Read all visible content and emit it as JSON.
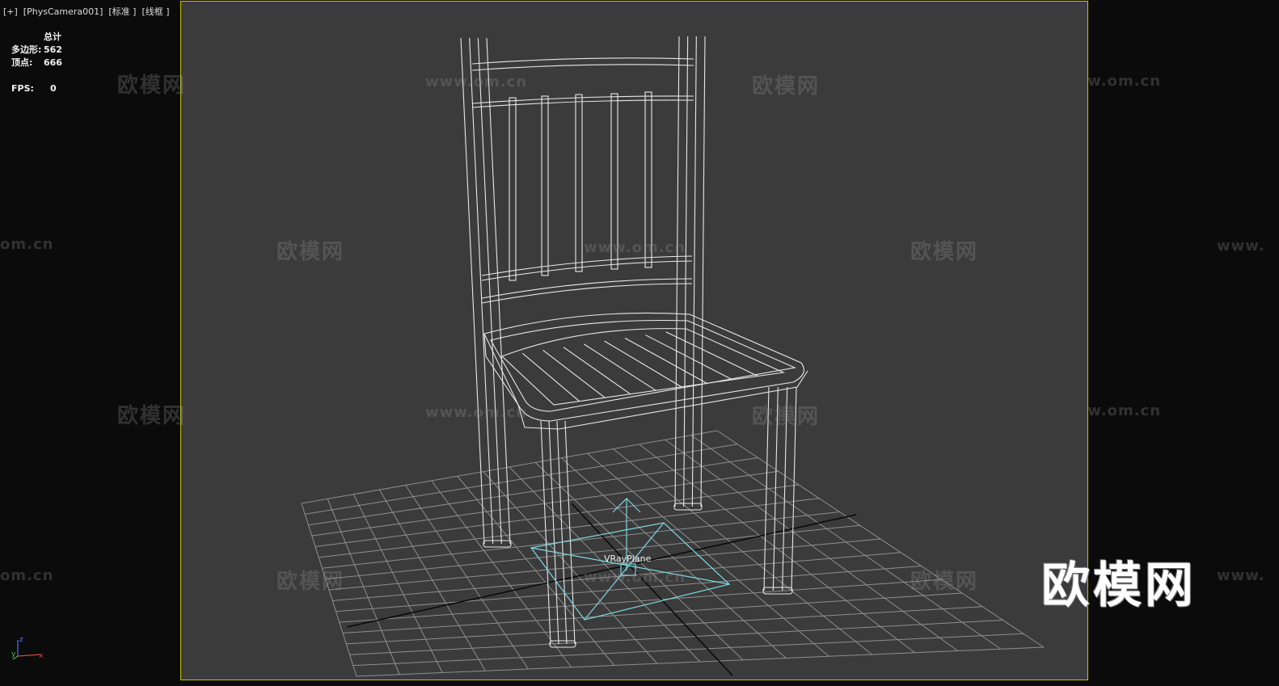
{
  "viewport_label": "[+]  [PhysCamera001]  [标准 ]  [线框 ]",
  "stats": {
    "header": "总计",
    "polys_label": "多边形:",
    "polys_value": "562",
    "verts_label": "顶点:",
    "verts_value": "666",
    "fps_label": "FPS:",
    "fps_value": "0"
  },
  "object_label": "VRayPlane",
  "watermarks": {
    "cn": "欧模网",
    "url": "www.om.cn",
    "url_partial_left": "om.cn",
    "url_partial_right": "www."
  },
  "brand": "欧模网",
  "axes": {
    "z": "z",
    "x": "x",
    "y": "y"
  },
  "colors": {
    "viewport_border": "#c8c400",
    "viewport_bg": "#3b3b3b",
    "wireframe": "#e8e8e8",
    "light_gizmo": "#7fd6e0"
  }
}
